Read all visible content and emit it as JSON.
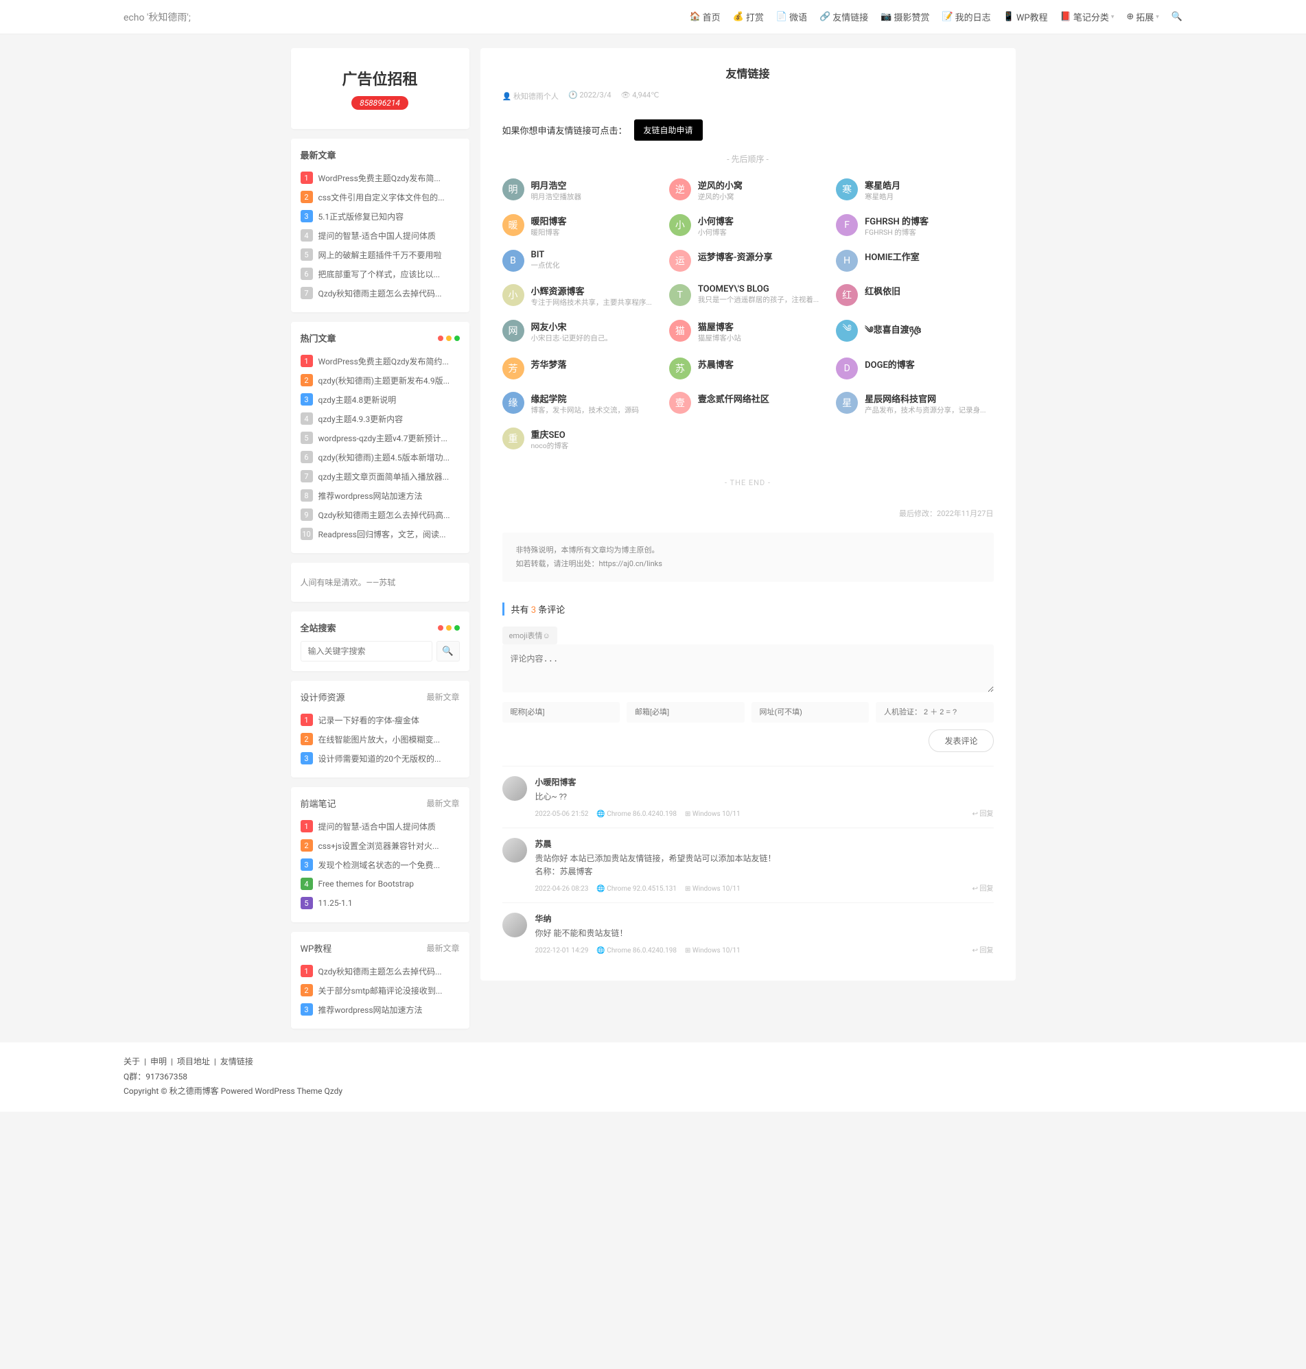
{
  "site": {
    "logo": "echo '秋知德雨';"
  },
  "nav": [
    {
      "icon": "🏠",
      "label": "首页"
    },
    {
      "icon": "💰",
      "label": "打赏"
    },
    {
      "icon": "📄",
      "label": "微语"
    },
    {
      "icon": "🔗",
      "label": "友情链接"
    },
    {
      "icon": "📷",
      "label": "摄影赞赏"
    },
    {
      "icon": "📝",
      "label": "我的日志"
    },
    {
      "icon": "📱",
      "label": "WP教程"
    },
    {
      "icon": "📕",
      "label": "笔记分类",
      "dropdown": true
    },
    {
      "icon": "⊕",
      "label": "拓展",
      "dropdown": true
    }
  ],
  "ad": {
    "title": "广告位招租",
    "phone": "858896214"
  },
  "sidebar": {
    "latest_title": "最新文章",
    "latest": [
      "WordPress免费主题Qzdy发布简...",
      "css文件引用自定义字体文件包的...",
      "5.1正式版修复已知内容",
      "提问的智慧-适合中国人提问体质",
      "网上的破解主题插件千万不要用啦",
      "把底部重写了个样式，应该比以...",
      "Qzdy秋知德雨主题怎么去掉代码..."
    ],
    "hot_title": "热门文章",
    "hot": [
      "WordPress免费主题Qzdy发布简约...",
      "qzdy(秋知德雨)主题更新发布4.9版...",
      "qzdy主题4.8更新说明",
      "qzdy主题4.9.3更新内容",
      "wordpress-qzdy主题v4.7更新预计...",
      "qzdy(秋知德雨)主题4.5版本新增功...",
      "qzdy主题文章页面简单插入播放器...",
      "推荐wordpress网站加速方法",
      "Qzdy秋知德雨主题怎么去掉代码高...",
      "Readpress回归博客，文艺，阅读..."
    ],
    "quote": "人间有味是清欢。——苏轼",
    "search_title": "全站搜索",
    "search_placeholder": "输入关键字搜索",
    "designer_title": "设计师资源",
    "more_label": "最新文章",
    "designer": [
      "记录一下好看的字体-瘦金体",
      "在线智能图片放大，小图模糊变...",
      "设计师需要知道的20个无版权的..."
    ],
    "frontend_title": "前端笔记",
    "frontend": [
      "提问的智慧-适合中国人提问体质",
      "css+js设置全浏览器兼容针对火...",
      "发现个检测域名状态的一个免费...",
      "Free themes for Bootstrap",
      "11.25-1.1"
    ],
    "wp_title": "WP教程",
    "wp": [
      "Qzdy秋知德雨主题怎么去掉代码...",
      "关于部分smtp邮箱评论没接收到...",
      "推荐wordpress网站加速方法"
    ]
  },
  "page": {
    "title": "友情链接",
    "author": "秋知德雨个人",
    "date": "2022/3/4",
    "views": "4,944℃",
    "apply_text": "如果你想申请友情链接可点击：",
    "apply_btn": "友链自助申请",
    "order_hint": "- 先后顺序 -",
    "the_end": "- THE END -",
    "last_mod": "最后修改：2022年11月27日",
    "notice1": "非特殊说明，本博所有文章均为博主原创。",
    "notice2_pre": "如若转载，请注明出处：",
    "notice2_url": "https://aj0.cn/links"
  },
  "links": [
    {
      "name": "明月浩空",
      "desc": "明月浩空播放器"
    },
    {
      "name": "逆风的小窝",
      "desc": "逆风的小窝"
    },
    {
      "name": "寒星皓月",
      "desc": "寒星皓月"
    },
    {
      "name": "暖阳博客",
      "desc": "暖阳博客"
    },
    {
      "name": "小何博客",
      "desc": "小何博客"
    },
    {
      "name": "FGHRSH 的博客",
      "desc": "FGHRSH 的博客"
    },
    {
      "name": "BIT",
      "desc": "一点优化"
    },
    {
      "name": "运梦博客-资源分享",
      "desc": ""
    },
    {
      "name": "HOMIE工作室",
      "desc": ""
    },
    {
      "name": "小辉资源博客",
      "desc": "专注于网络技术共享，主要共享程序..."
    },
    {
      "name": "TOOMEY\\'S BLOG",
      "desc": "我只是一个逍遥群居的孩子，注视着..."
    },
    {
      "name": "红枫依旧",
      "desc": ""
    },
    {
      "name": "网友小宋",
      "desc": "小宋日志-记更好的自己。"
    },
    {
      "name": "猫屋博客",
      "desc": "猫屋博客小站"
    },
    {
      "name": "༄悲喜自渡ཉ꧔ꦿ",
      "desc": ""
    },
    {
      "name": "芳华梦落",
      "desc": ""
    },
    {
      "name": "苏晨博客",
      "desc": ""
    },
    {
      "name": "DOGE的博客",
      "desc": ""
    },
    {
      "name": "缘起学院",
      "desc": "博客，发卡网站，技术交流，源码"
    },
    {
      "name": "壹念贰仟网络社区",
      "desc": ""
    },
    {
      "name": "星辰网络科技官网",
      "desc": "产品发布，技术与资源分享，记录身..."
    },
    {
      "name": "重庆SEO",
      "desc": "noco的博客"
    }
  ],
  "comment_form": {
    "title_pre": "共有 ",
    "count": "3",
    "title_post": " 条评论",
    "emoji_btn": "emoji表情☺",
    "placeholder": "评论内容...",
    "nick": "昵称[必填]",
    "email": "邮箱[必填]",
    "url": "网址(可不填)",
    "captcha": "人机验证： 2 ＋ 2 = ?",
    "submit": "发表评论"
  },
  "comments": [
    {
      "author": "小暖阳博客",
      "text": "比心~ ??",
      "time": "2022-05-06 21:52",
      "browser": "Chrome 86.0.4240.198",
      "os": "Windows 10/11",
      "reply": "回复"
    },
    {
      "author": "苏晨",
      "text": "贵站你好 本站已添加贵站友情链接，希望贵站可以添加本站友链！\n名称：苏晨博客",
      "time": "2022-04-26 08:23",
      "browser": "Chrome 92.0.4515.131",
      "os": "Windows 10/11",
      "reply": "回复"
    },
    {
      "author": "华纳",
      "text": "你好 能不能和贵站友链！",
      "time": "2022-12-01 14:29",
      "browser": "Chrome 86.0.4240.198",
      "os": "Windows 10/11",
      "reply": "回复"
    }
  ],
  "footer": {
    "links": [
      "关于",
      "申明",
      "项目地址",
      "友情链接"
    ],
    "sep": " | ",
    "qq_label": "Q群：",
    "qq": "917367358",
    "copyright": "Copyright © 秋之德雨博客 Powered WordPress Theme Qzdy"
  }
}
